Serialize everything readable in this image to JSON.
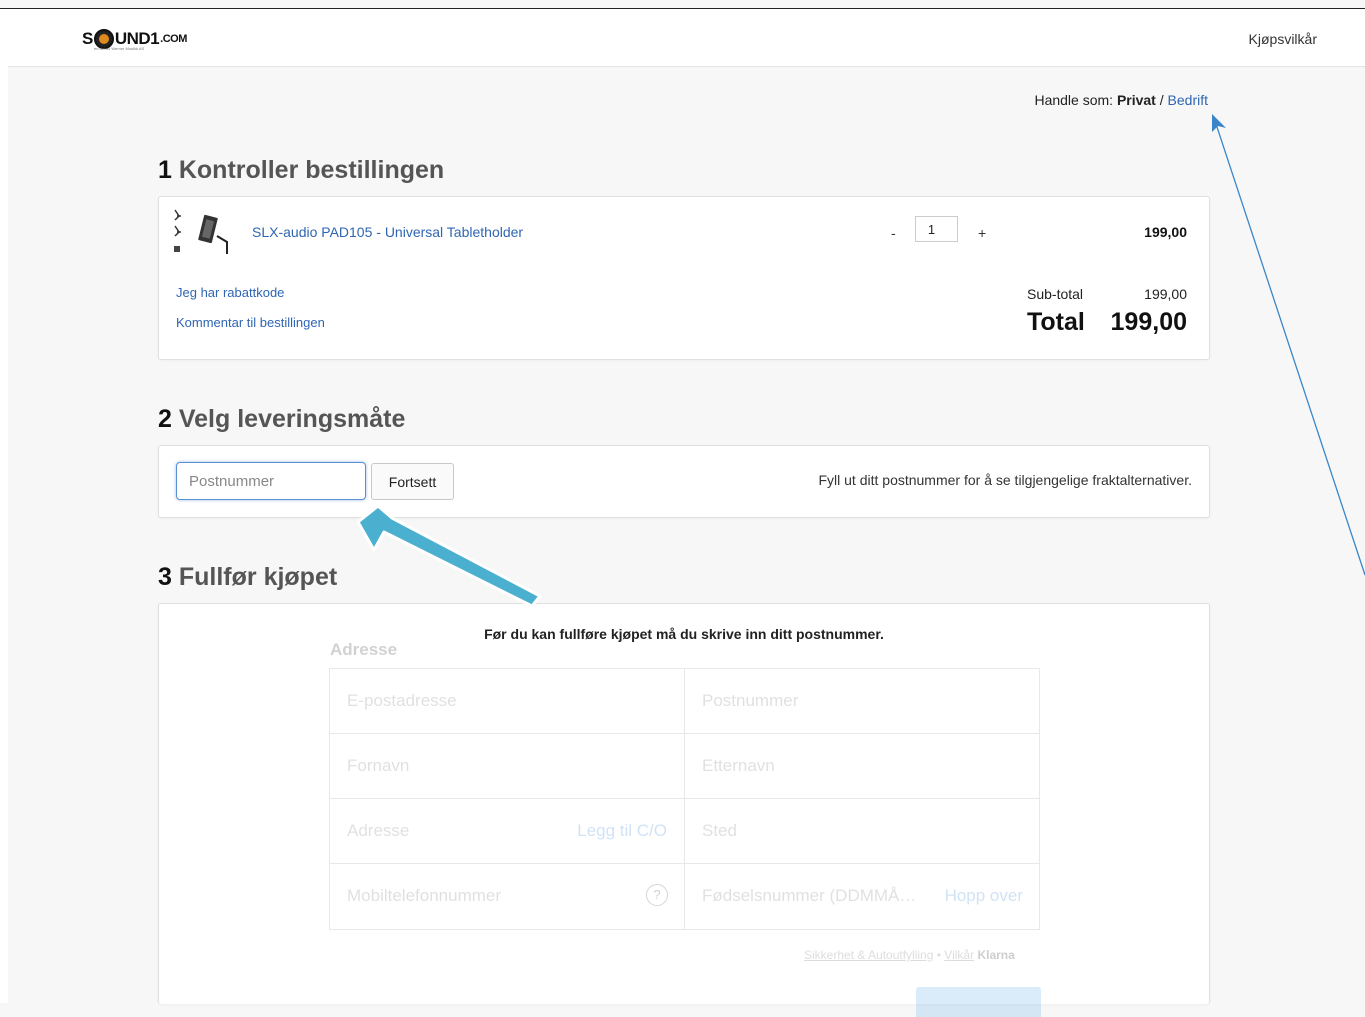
{
  "header": {
    "logo": {
      "name": "SOUND1.COM",
      "before_o": "S",
      "after_o": "UND1",
      "suffix": ".COM",
      "tagline": "en del av Werner Musikk AS"
    },
    "terms_link": "Kjøpsvilkår"
  },
  "shop_as": {
    "label": "Handle som:",
    "private": "Privat",
    "separator": "/",
    "business": "Bedrift"
  },
  "sections": {
    "order": {
      "number": "1",
      "title": "Kontroller bestillingen",
      "item": {
        "name": "SLX-audio PAD105 - Universal Tabletholder",
        "qty_minus": "-",
        "quantity": "1",
        "qty_plus": "+",
        "price": "199,00"
      },
      "discount_link": "Jeg har rabattkode",
      "comment_link": "Kommentar til bestillingen",
      "subtotal_label": "Sub-total",
      "subtotal_value": "199,00",
      "total_label": "Total",
      "total_value": "199,00"
    },
    "delivery": {
      "number": "2",
      "title": "Velg leveringsmåte",
      "postal_placeholder": "Postnummer",
      "continue_button": "Fortsett",
      "hint": "Fyll ut ditt postnummer for å se tilgjengelige fraktalternativer."
    },
    "checkout": {
      "number": "3",
      "title": "Fullfør kjøpet",
      "blocker_message": "Før du kan fullføre kjøpet må du skrive inn ditt postnummer.",
      "address_title": "Adresse",
      "fields": {
        "email": "E-postadresse",
        "postal": "Postnummer",
        "first_name": "Fornavn",
        "last_name": "Etternavn",
        "address": "Adresse",
        "add_co": "Legg til C/O",
        "city": "Sted",
        "mobile": "Mobiltelefonnummer",
        "help": "?",
        "birth_number": "Fødselsnummer (DDMMÅ…",
        "skip": "Hopp over"
      },
      "footer": {
        "security": "Sikkerhet & Autoutfylling",
        "dot": "•",
        "terms": "Vilkår",
        "brand": "Klarna"
      }
    }
  },
  "colors": {
    "link": "#2f66b3",
    "annotation_arrow": "#4bb0d0",
    "annotation_line": "#3a86c8"
  }
}
